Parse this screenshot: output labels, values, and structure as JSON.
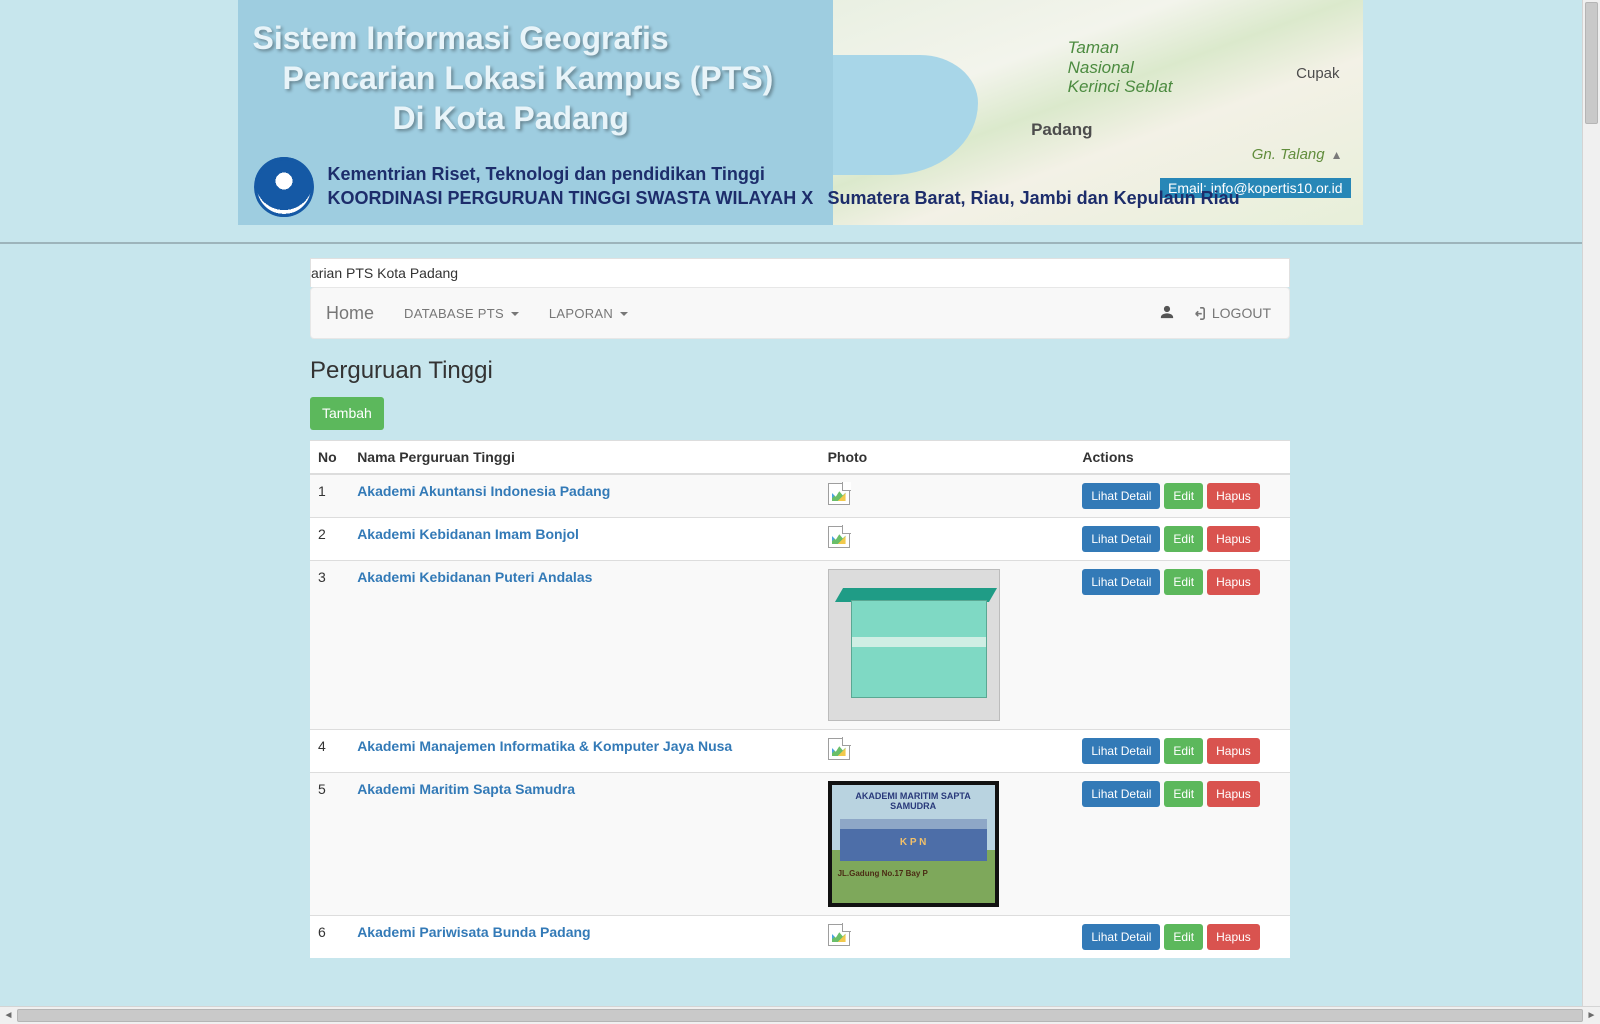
{
  "banner": {
    "title_l1": "Sistem Informasi Geografis",
    "title_l2": "Pencarian Lokasi Kampus  (PTS)",
    "title_l3": "Di Kota Padang",
    "sub1": "Kementrian Riset, Teknologi dan pendidikan Tinggi",
    "sub2": "KOORDINASI PERGURUAN TINGGI SWASTA  WILAYAH X",
    "regions": "Sumatera Barat, Riau, Jambi dan Kepulaun Riau",
    "email_label": "Email: info@kopertis10.or.id",
    "map": {
      "park": "Taman\nNasional\nKerinci Seblat",
      "city_right": "Cupak",
      "city_main": "Padang",
      "mountain": "Gn. Talang"
    }
  },
  "crumb": "arian PTS Kota Padang",
  "nav": {
    "brand": "Home",
    "items": [
      "DATABASE PTS",
      "LAPORAN"
    ],
    "logout": "LOGOUT"
  },
  "page_title": "Perguruan Tinggi",
  "add_button": "Tambah",
  "columns": {
    "no": "No",
    "name": "Nama Perguruan Tinggi",
    "photo": "Photo",
    "actions": "Actions"
  },
  "action_labels": {
    "detail": "Lihat Detail",
    "edit": "Edit",
    "delete": "Hapus"
  },
  "rows": [
    {
      "no": "1",
      "name": "Akademi Akuntansi Indonesia Padang",
      "photo": "broken"
    },
    {
      "no": "2",
      "name": "Akademi Kebidanan Imam Bonjol",
      "photo": "broken"
    },
    {
      "no": "3",
      "name": "Akademi Kebidanan Puteri Andalas",
      "photo": "building"
    },
    {
      "no": "4",
      "name": "Akademi Manajemen Informatika & Komputer Jaya Nusa",
      "photo": "broken"
    },
    {
      "no": "5",
      "name": "Akademi Maritim Sapta Samudra",
      "photo": "maritime"
    },
    {
      "no": "6",
      "name": "Akademi Pariwisata Bunda Padang",
      "photo": "broken"
    }
  ],
  "maritime_photo": {
    "title": "AKADEMI MARITIM SAPTA SAMUDRA",
    "kpn": "K P N",
    "addr": "JL.Gadung No.17  Bay P"
  }
}
